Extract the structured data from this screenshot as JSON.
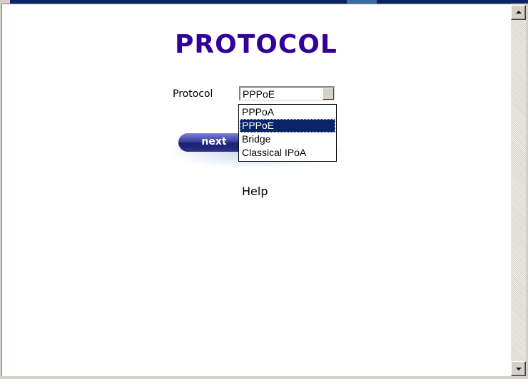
{
  "page": {
    "title": "PROTOCOL",
    "protocol_label": "Protocol",
    "help_link": "Help"
  },
  "protocol_select": {
    "selected_value": "PPPoE",
    "options": [
      "PPPoA",
      "PPPoE",
      "Bridge",
      "Classical IPoA"
    ],
    "highlighted_index": 1
  },
  "next_button": {
    "label": "next"
  },
  "colors": {
    "title": "#330099",
    "highlight": "#0a246a",
    "button_dark": "#1d2170"
  }
}
